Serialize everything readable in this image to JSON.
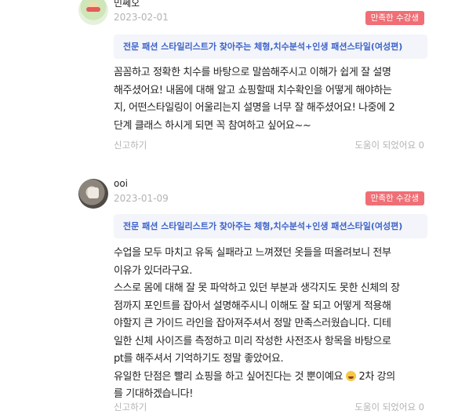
{
  "reviews": [
    {
      "name": "민쎄오",
      "date": "2023-02-01",
      "badge": "만족한 수강생",
      "course": "전문 패션 스타일리스트가 찾아주는 체형,치수분석+인생 패션스타일(여성편)",
      "body": "꼼꼼하고 정확한 치수를 바탕으로 말씀해주시고 이해가 쉽게 잘 설명\n해주셨어요! 내몸에 대해 알고 쇼핑할때 치수확인을 어떻게 해야하는\n지, 어떤스타일링이 어울리는지 설명을 너무 잘 해주셨어요! 나중에 2\n단계 클래스 하시게 되면 꼭 참여하고 싶어요~~",
      "report": "신고하기",
      "helpful": "도움이 되었어요 0"
    },
    {
      "name": "ooi",
      "date": "2023-01-09",
      "badge": "만족한 수강생",
      "course": "전문 패션 스타일리스트가 찾아주는 체형,치수분석+인생 패션스타일(여성편)",
      "body_lines": [
        "수업을 모두 마치고 유독 실패라고 느껴졌던 옷들을 떠올려보니 전부",
        "이유가 있더라구요.",
        "스스로 몸에 대해 잘 못 파악하고 있던 부분과 생각지도 못한 신체의 장",
        "점까지 포인트를 잡아서 설명해주시니 이해도 잘 되고 어떻게 적용해",
        "야할지 큰 가이드 라인을 잡아져주셔서 정말 만족스러웠습니다. 디테",
        "일한 신체 사이즈를 측정하고 미리 작성한 사전조사 항목을 바탕으로",
        "pt를 해주셔서 기억하기도 정말 좋았어요.",
        "유일한 단점은 빨리 쇼핑을 하고 싶어진다는 것 뿐이예요",
        "2차 강의",
        "를 기대하겠습니다!"
      ],
      "report": "신고하기",
      "helpful": "도움이 되었어요 0"
    }
  ],
  "icons": {
    "avatar_1": "avatar-icon",
    "avatar_2": "avatar-icon",
    "emoji": "laughing-emoji-icon"
  },
  "colors": {
    "badge": "#f06e75",
    "course_text": "#3d63c9",
    "course_bg": "#f3f5fa",
    "muted": "#b3b3b3"
  }
}
